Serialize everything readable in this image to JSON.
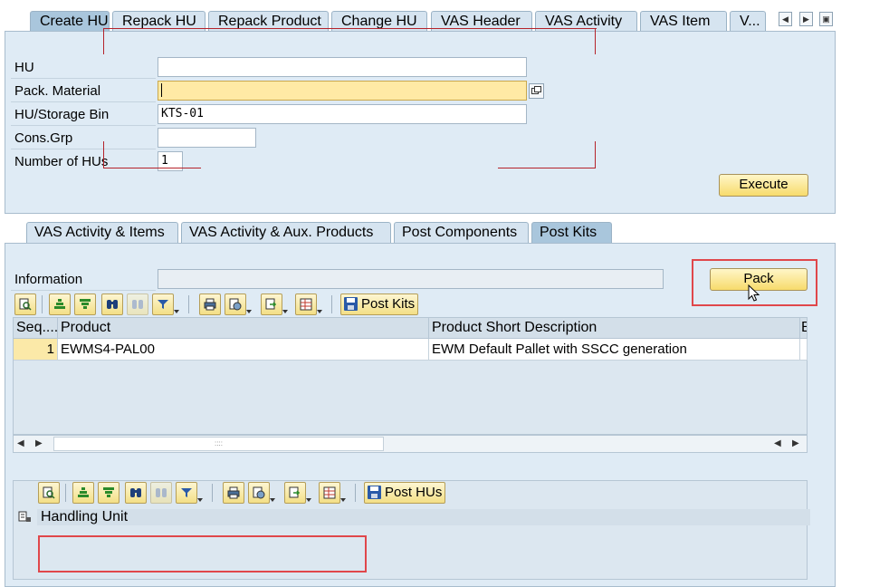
{
  "top_tabs": [
    {
      "label": "Create HU"
    },
    {
      "label": "Repack HU"
    },
    {
      "label": "Repack Product"
    },
    {
      "label": "Change HU"
    },
    {
      "label": "VAS Header"
    },
    {
      "label": "VAS Activity"
    },
    {
      "label": "VAS Item"
    },
    {
      "label": "V..."
    }
  ],
  "create_hu": {
    "hu_label": "HU",
    "hu_value": "",
    "pack_material_label": "Pack. Material",
    "pack_material_value": "",
    "storage_bin_label": "HU/Storage Bin",
    "storage_bin_value": "KTS-01",
    "cons_grp_label": "Cons.Grp",
    "cons_grp_value": "",
    "num_hus_label": "Number of HUs",
    "num_hus_value": "1",
    "execute_label": "Execute"
  },
  "sub_tabs": [
    {
      "label": "VAS Activity & Items"
    },
    {
      "label": "VAS Activity & Aux. Products"
    },
    {
      "label": "Post Components"
    },
    {
      "label": "Post Kits"
    }
  ],
  "post_kits": {
    "information_label": "Information",
    "information_value": "",
    "pack_label": "Pack",
    "post_kits_label": "Post Kits",
    "post_hus_label": "Post HUs",
    "columns": [
      "Seq....",
      "Product",
      "Product Short Description",
      "B"
    ],
    "rows": [
      {
        "seq": "1",
        "product": "EWMS4-PAL00",
        "description": "EWM Default Pallet with SSCC generation"
      }
    ],
    "scroll_grip": "::::",
    "hu_header": "Handling Unit"
  },
  "colors": {
    "accent_button": "#f7db6c",
    "highlight_box": "#e0474b",
    "panel_bg": "#dfebf5"
  }
}
